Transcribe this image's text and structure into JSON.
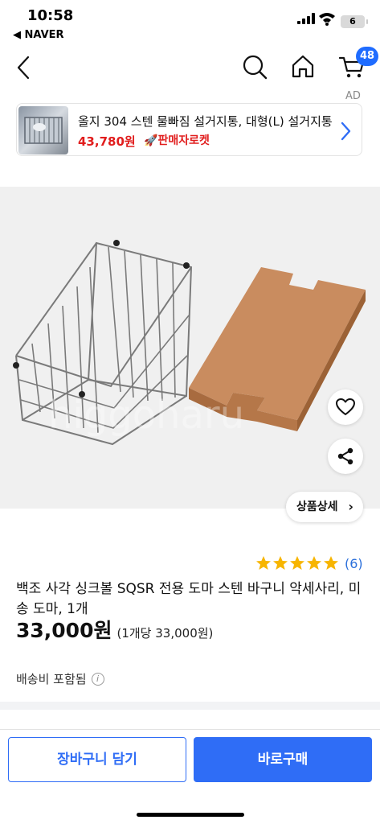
{
  "status_bar": {
    "time": "10:58",
    "back_app": "◀ NAVER",
    "battery": "6"
  },
  "header": {
    "cart_count": "48"
  },
  "ad": {
    "label": "AD",
    "title": "올지 304 스텐 물빠짐 설거지통, 대형(L) 설거지통",
    "price": "43,780원",
    "rocket": "판매자로켓"
  },
  "product": {
    "detail_button": "상품상세",
    "rating_stars": 5,
    "review_count": "(6)",
    "name": "백조 사각 싱크볼 SQSR 전용 도마 스텐 바구니 악세사리, 미송 도마, 1개",
    "price": "33,000원",
    "unit_price": "(1개당 33,000원)",
    "shipping": "배송비 포함됨",
    "watermark": "higgoharu"
  },
  "bottom": {
    "cart_button": "장바구니 담기",
    "buy_button": "바로구매"
  },
  "colors": {
    "accent": "#2f6df6",
    "price_red": "#e11d1d",
    "star": "#f7b500"
  }
}
